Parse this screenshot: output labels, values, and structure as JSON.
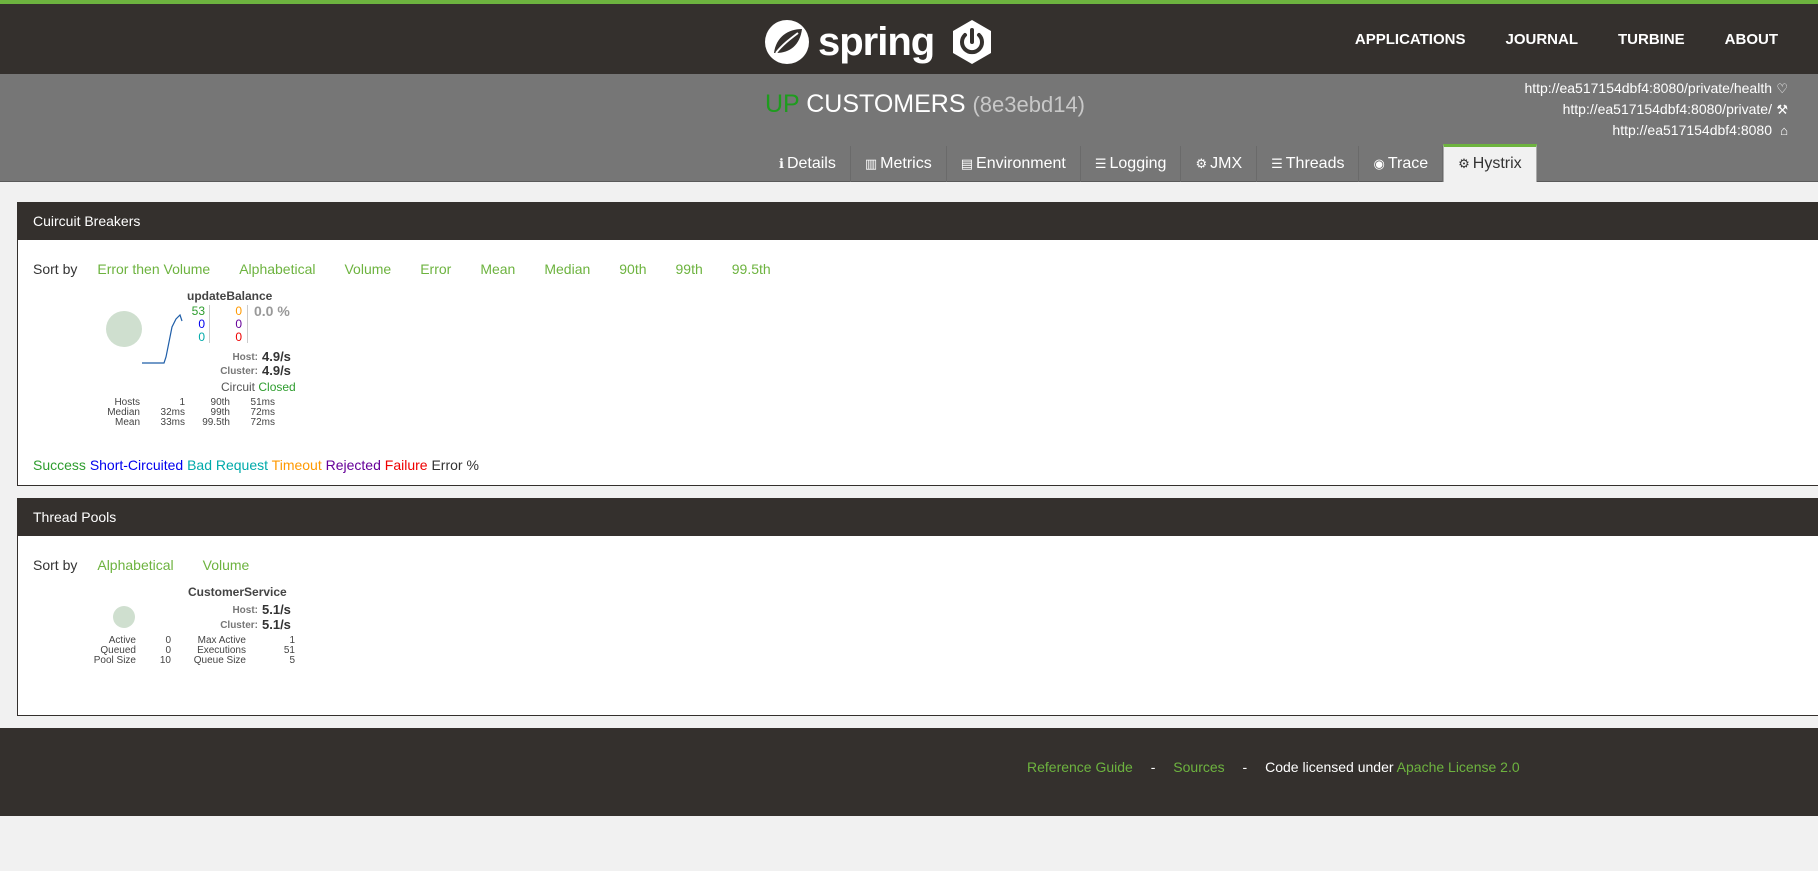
{
  "nav": {
    "brand": "spring",
    "items": [
      "APPLICATIONS",
      "JOURNAL",
      "TURBINE",
      "ABOUT"
    ]
  },
  "header": {
    "status": "UP",
    "app_name": "CUSTOMERS",
    "app_id": "(8e3ebd14)",
    "urls": {
      "health": "http://ea517154dbf4:8080/private/health",
      "management": "http://ea517154dbf4:8080/private/",
      "service": "http://ea517154dbf4:8080"
    },
    "tabs": [
      "Details",
      "Metrics",
      "Environment",
      "Logging",
      "JMX",
      "Threads",
      "Trace",
      "Hystrix"
    ],
    "active_tab": "Hystrix"
  },
  "circuit_breakers": {
    "title": "Cuircuit Breakers",
    "sort_label": "Sort by",
    "sort_options": [
      "Error then Volume",
      "Alphabetical",
      "Volume",
      "Error",
      "Mean",
      "Median",
      "90th",
      "99th",
      "99.5th"
    ],
    "item": {
      "name": "updateBalance",
      "counts": {
        "success": "53",
        "short_circuited": "0",
        "bad_request": "0",
        "timeout": "0",
        "rejected": "0",
        "failure": "0"
      },
      "error_pct": "0.0 %",
      "host_label": "Host:",
      "host_rate": "4.9/s",
      "cluster_label": "Cluster:",
      "cluster_rate": "4.9/s",
      "circuit_label": "Circuit",
      "circuit_state": "Closed",
      "stats_left": [
        [
          "Hosts",
          "1"
        ],
        [
          "Median",
          "32ms"
        ],
        [
          "Mean",
          "33ms"
        ]
      ],
      "stats_right": [
        [
          "90th",
          "51ms"
        ],
        [
          "99th",
          "72ms"
        ],
        [
          "99.5th",
          "72ms"
        ]
      ]
    },
    "legend": [
      "Success",
      "Short-Circuited",
      "Bad Request",
      "Timeout",
      "Rejected",
      "Failure",
      "Error %"
    ]
  },
  "thread_pools": {
    "title": "Thread Pools",
    "sort_label": "Sort by",
    "sort_options": [
      "Alphabetical",
      "Volume"
    ],
    "item": {
      "name": "CustomerService",
      "host_label": "Host:",
      "host_rate": "5.1/s",
      "cluster_label": "Cluster:",
      "cluster_rate": "5.1/s",
      "stats_left": [
        [
          "Active",
          "0"
        ],
        [
          "Queued",
          "0"
        ],
        [
          "Pool Size",
          "10"
        ]
      ],
      "stats_right": [
        [
          "Max Active",
          "1"
        ],
        [
          "Executions",
          "51"
        ],
        [
          "Queue Size",
          "5"
        ]
      ]
    }
  },
  "footer": {
    "reference_guide": "Reference Guide",
    "sep": "-",
    "sources": "Sources",
    "licensed": "Code licensed under",
    "license": "Apache License 2.0"
  },
  "colors": {
    "accent": "#6db33f",
    "navbar": "#34302d",
    "header": "#767676",
    "status_up": "#1e9c1e",
    "success": "#2e9d2e",
    "short_circuited": "#0000ee",
    "bad_request": "#00aaaa",
    "timeout": "#ff9900",
    "rejected": "#660099",
    "failure": "#ee0000"
  }
}
